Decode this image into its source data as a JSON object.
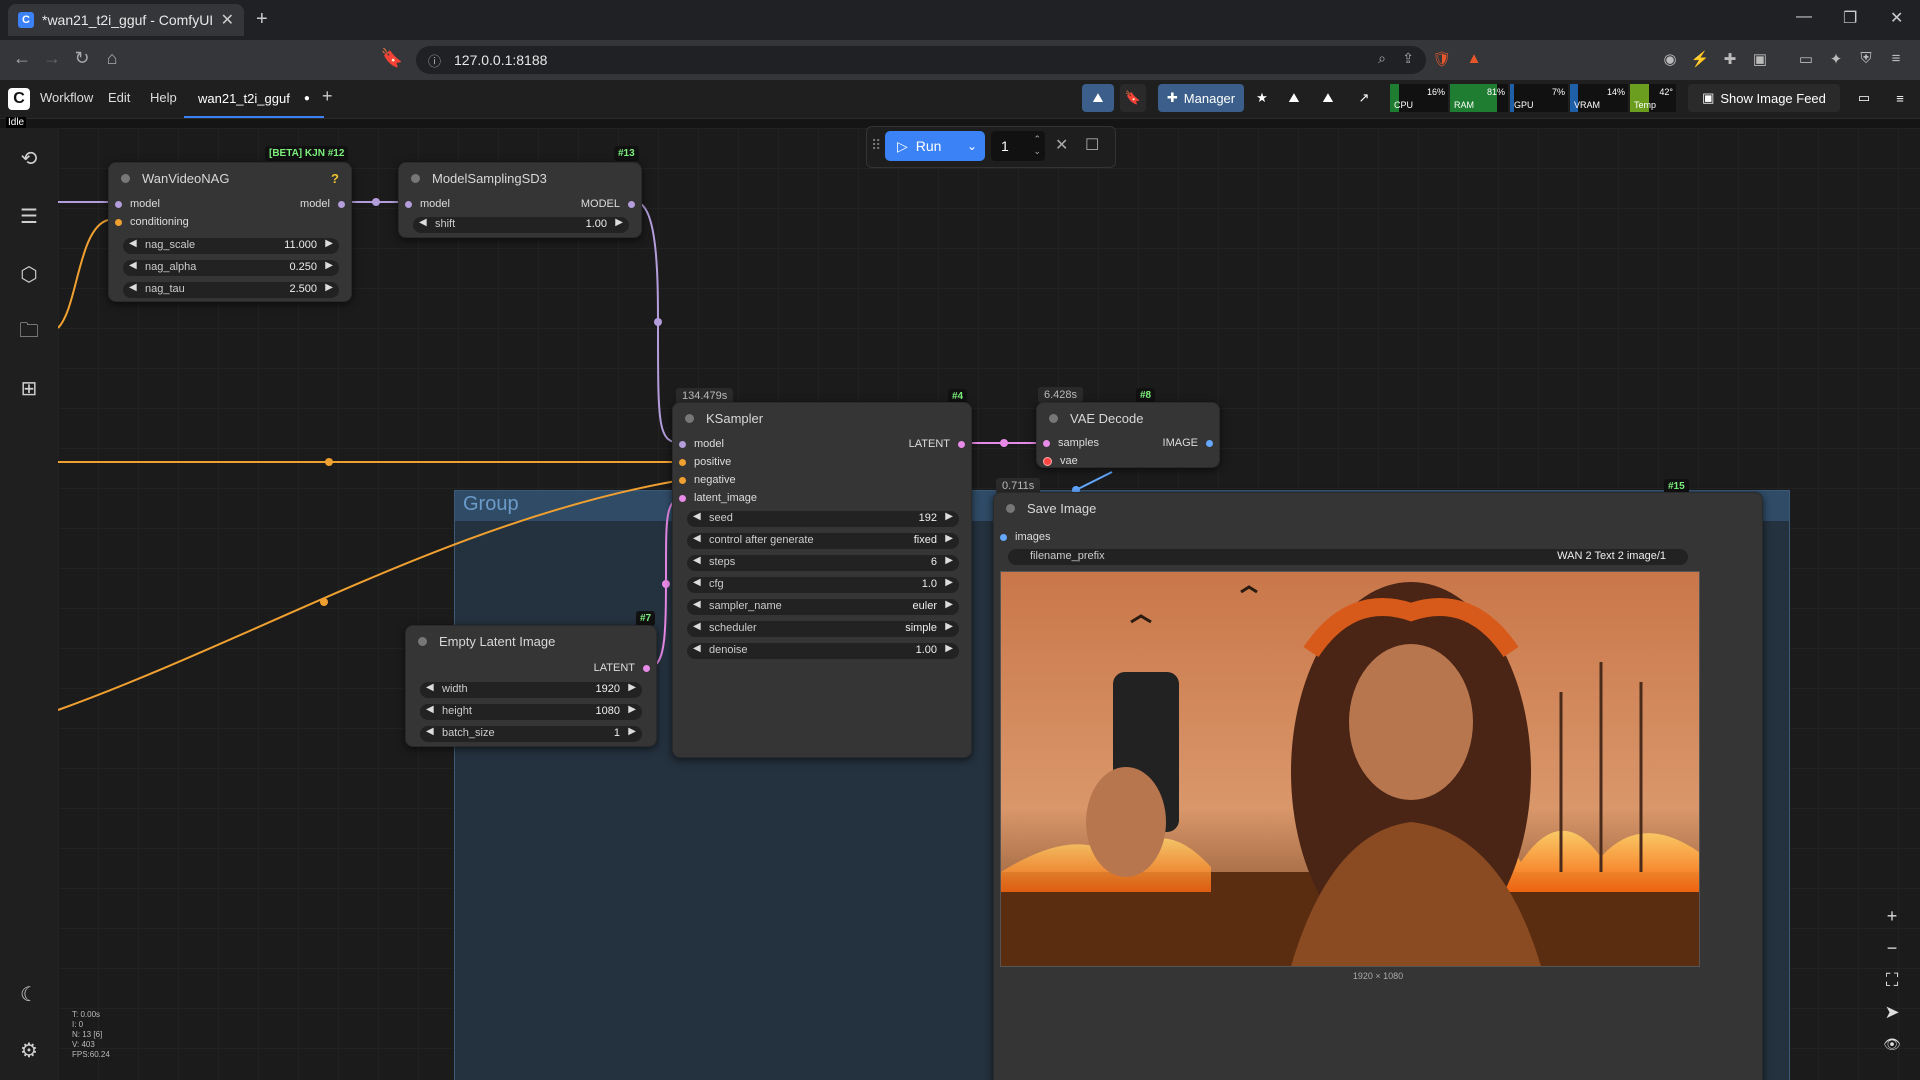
{
  "browser": {
    "tab_title": "*wan21_t2i_gguf - ComfyUI",
    "url": "127.0.0.1:8188"
  },
  "menubar": {
    "items": [
      "Workflow",
      "Edit",
      "Help"
    ],
    "workflow_tab": "wan21_t2i_gguf",
    "manager_label": "Manager",
    "show_image_feed": "Show Image Feed",
    "status": "Idle",
    "meters": [
      {
        "label": "CPU",
        "value": "16%",
        "fraction": 0.16,
        "color": "#1e7d31"
      },
      {
        "label": "RAM",
        "value": "81%",
        "fraction": 0.81,
        "color": "#1e7d31"
      },
      {
        "label": "GPU",
        "value": "7%",
        "fraction": 0.07,
        "color": "#1e5fa8"
      },
      {
        "label": "VRAM",
        "value": "14%",
        "fraction": 0.14,
        "color": "#1e5fa8"
      },
      {
        "label": "Temp",
        "value": "42°",
        "fraction": 0.42,
        "color": "#6b9e1e"
      }
    ]
  },
  "runbar": {
    "run_label": "Run",
    "count": "1"
  },
  "group": {
    "title": "Group"
  },
  "nodes": {
    "nag": {
      "badge": "[BETA] KJN #12",
      "title": "WanVideoNAG",
      "help": "?",
      "inputs": [
        "model",
        "conditioning"
      ],
      "output": "model",
      "widgets": [
        {
          "label": "nag_scale",
          "value": "11.000"
        },
        {
          "label": "nag_alpha",
          "value": "0.250"
        },
        {
          "label": "nag_tau",
          "value": "2.500"
        }
      ]
    },
    "msd3": {
      "badge": "#13",
      "title": "ModelSamplingSD3",
      "input": "model",
      "output": "MODEL",
      "widgets": [
        {
          "label": "shift",
          "value": "1.00"
        }
      ]
    },
    "ksampler": {
      "time": "134.479s",
      "badge": "#4",
      "title": "KSampler",
      "inputs": [
        "model",
        "positive",
        "negative",
        "latent_image"
      ],
      "output": "LATENT",
      "widgets": [
        {
          "label": "seed",
          "value": "192"
        },
        {
          "label": "control after generate",
          "value": "fixed"
        },
        {
          "label": "steps",
          "value": "6"
        },
        {
          "label": "cfg",
          "value": "1.0"
        },
        {
          "label": "sampler_name",
          "value": "euler"
        },
        {
          "label": "scheduler",
          "value": "simple"
        },
        {
          "label": "denoise",
          "value": "1.00"
        }
      ]
    },
    "vae": {
      "time": "6.428s",
      "badge": "#8",
      "title": "VAE Decode",
      "inputs": [
        "samples",
        "vae"
      ],
      "output": "IMAGE"
    },
    "save": {
      "time": "0.711s",
      "badge": "#15",
      "title": "Save Image",
      "input": "images",
      "widget": {
        "label": "filename_prefix",
        "value": "WAN 2 Text 2 image/1"
      },
      "image_size": "1920 × 1080"
    },
    "latent": {
      "badge": "#7",
      "title": "Empty Latent Image",
      "output": "LATENT",
      "widgets": [
        {
          "label": "width",
          "value": "1920"
        },
        {
          "label": "height",
          "value": "1080"
        },
        {
          "label": "batch_size",
          "value": "1"
        }
      ]
    }
  },
  "stats": [
    "T: 0.00s",
    "I: 0",
    "N: 13 [6]",
    "V: 403",
    "FPS:60.24"
  ]
}
